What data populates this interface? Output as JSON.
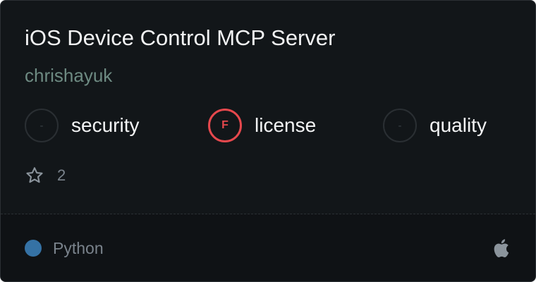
{
  "card": {
    "title": "iOS Device Control MCP Server",
    "author": "chrishayuk"
  },
  "scores": [
    {
      "grade": "-",
      "label": "security",
      "status": "unrated"
    },
    {
      "grade": "F",
      "label": "license",
      "status": "fail",
      "color": "#e5484d"
    },
    {
      "grade": "-",
      "label": "quality",
      "status": "unrated"
    }
  ],
  "stars": {
    "icon": "star-outline-icon",
    "count": "2"
  },
  "footer": {
    "language": "Python",
    "language_color": "#3572a5",
    "platform_icon": "apple-icon"
  }
}
